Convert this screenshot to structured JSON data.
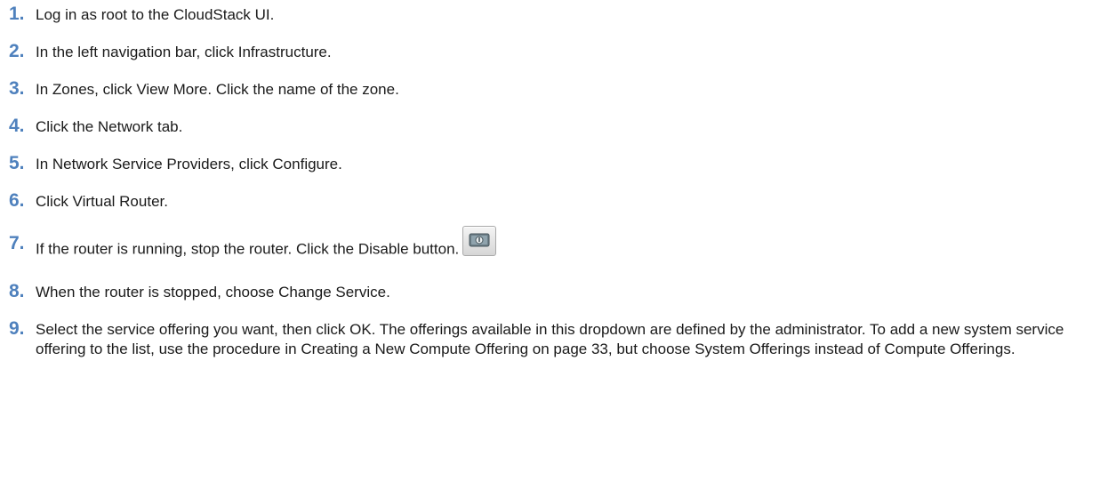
{
  "steps": [
    {
      "num": "1.",
      "text": "Log in as root to the CloudStack UI."
    },
    {
      "num": "2.",
      "text": "In the left navigation bar, click Infrastructure."
    },
    {
      "num": "3.",
      "text": "In Zones, click View More. Click the name of the zone."
    },
    {
      "num": "4.",
      "text": "Click the Network tab."
    },
    {
      "num": "5.",
      "text": "In Network Service Providers, click Configure."
    },
    {
      "num": "6.",
      "text": "Click Virtual Router."
    },
    {
      "num": "7.",
      "text": "If the router is running, stop the router. Click the Disable button.",
      "icon": "disable-router-icon"
    },
    {
      "num": "8.",
      "text": "When the router is stopped, choose Change Service."
    },
    {
      "num": "9.",
      "text": "Select the service offering you want, then click OK. The offerings available in this dropdown are defined by the administrator. To add a new system service offering to the list, use the procedure in Creating a New Compute Offering on page 33, but choose System Offerings instead of Compute Offerings."
    }
  ],
  "colors": {
    "step_number": "#4f81bd",
    "body_text": "#1a1a1a"
  }
}
